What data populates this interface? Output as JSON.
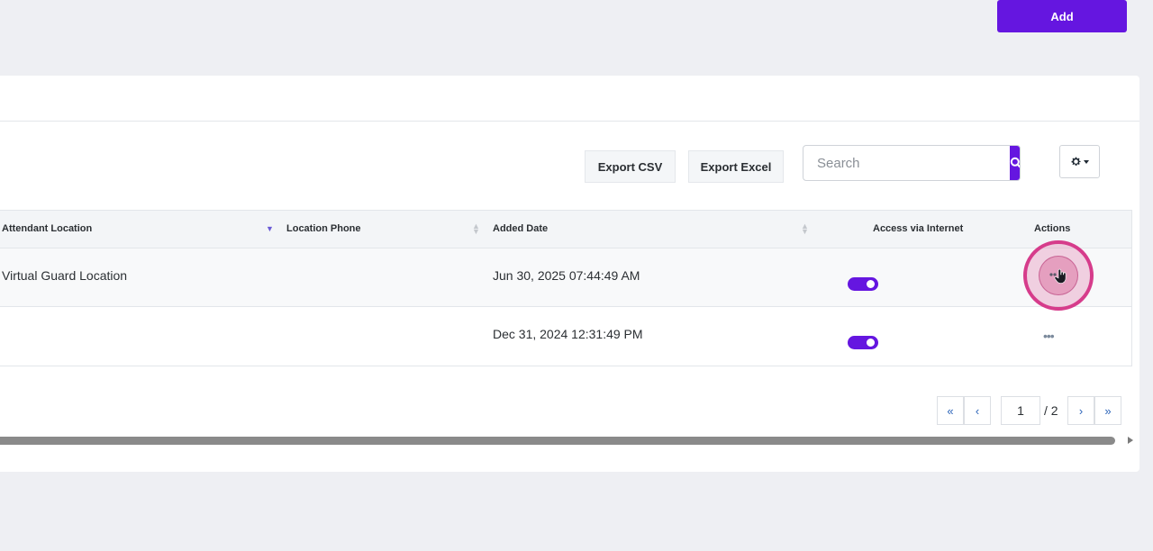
{
  "header": {
    "add_label": "Add"
  },
  "toolbar": {
    "export_csv_label": "Export CSV",
    "export_excel_label": "Export Excel",
    "search_placeholder": "Search"
  },
  "table": {
    "columns": [
      "Attendant Location",
      "Location Phone",
      "Added Date",
      "Access via Internet",
      "Actions"
    ],
    "rows": [
      {
        "attendant_location": "Virtual Guard Location",
        "location_phone": "",
        "added_date": "Jun 30, 2025 07:44:49 AM",
        "access_via_internet": true
      },
      {
        "attendant_location": "",
        "location_phone": "",
        "added_date": "Dec 31, 2024 12:31:49 PM",
        "access_via_internet": true
      }
    ]
  },
  "pagination": {
    "current_page": "1",
    "total_label": "/ 2",
    "first": "«",
    "prev": "‹",
    "next": "›",
    "last": "»"
  },
  "colors": {
    "accent": "#6516e0",
    "highlight": "#d63c8b"
  }
}
